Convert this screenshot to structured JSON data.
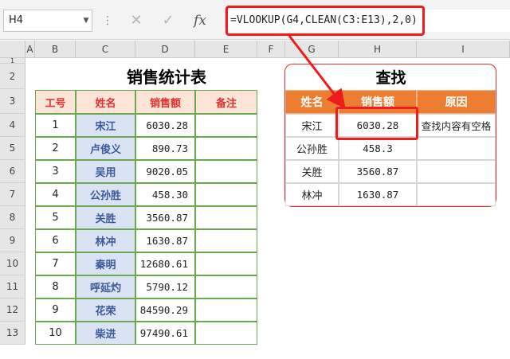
{
  "formula_bar": {
    "name_box": "H4",
    "dropdown_glyph": "▼",
    "more_glyph": "⋮",
    "cancel_glyph": "✕",
    "enter_glyph": "✓",
    "fx_label": "fx",
    "formula": "=VLOOKUP(G4,CLEAN(C3:E13),2,0)"
  },
  "columns": [
    "A",
    "B",
    "C",
    "D",
    "E",
    "F",
    "G",
    "H",
    "I"
  ],
  "rows": [
    "1",
    "2",
    "3",
    "4",
    "5",
    "6",
    "7",
    "8",
    "9",
    "10",
    "11",
    "12",
    "13"
  ],
  "left_table": {
    "title": "销售统计表",
    "headers": [
      "工号",
      "姓名",
      "销售额",
      "备注"
    ],
    "rows": [
      {
        "id": "1",
        "name": "宋江",
        "sales": "6030.28",
        "note": ""
      },
      {
        "id": "2",
        "name": "卢俊义",
        "sales": "890.73",
        "note": ""
      },
      {
        "id": "3",
        "name": "吴用",
        "sales": "9020.05",
        "note": ""
      },
      {
        "id": "4",
        "name": "公孙胜",
        "sales": "458.30",
        "note": ""
      },
      {
        "id": "5",
        "name": "关胜",
        "sales": "3560.87",
        "note": ""
      },
      {
        "id": "6",
        "name": "林冲",
        "sales": "1630.87",
        "note": ""
      },
      {
        "id": "7",
        "name": "秦明",
        "sales": "12680.61",
        "note": ""
      },
      {
        "id": "8",
        "name": "呼延灼",
        "sales": "5790.12",
        "note": ""
      },
      {
        "id": "9",
        "name": "花荣",
        "sales": "84590.29",
        "note": ""
      },
      {
        "id": "10",
        "name": "柴进",
        "sales": "97490.61",
        "note": ""
      }
    ]
  },
  "right_table": {
    "title": "查找",
    "headers": [
      "姓名",
      "销售额",
      "原因"
    ],
    "rows": [
      {
        "name": "宋江",
        "sales": "6030.28",
        "reason": "查找内容有空格"
      },
      {
        "name": "公孙胜",
        "sales": "458.3",
        "reason": ""
      },
      {
        "name": "关胜",
        "sales": "3560.87",
        "reason": ""
      },
      {
        "name": "林冲",
        "sales": "1630.87",
        "reason": ""
      }
    ]
  },
  "colors": {
    "highlight": "#ee1c1c",
    "right_header": "#ed7d31",
    "left_header_fill": "#fce4d6",
    "name_fill": "#dae3f3",
    "grid_border": "#6aa84f"
  }
}
